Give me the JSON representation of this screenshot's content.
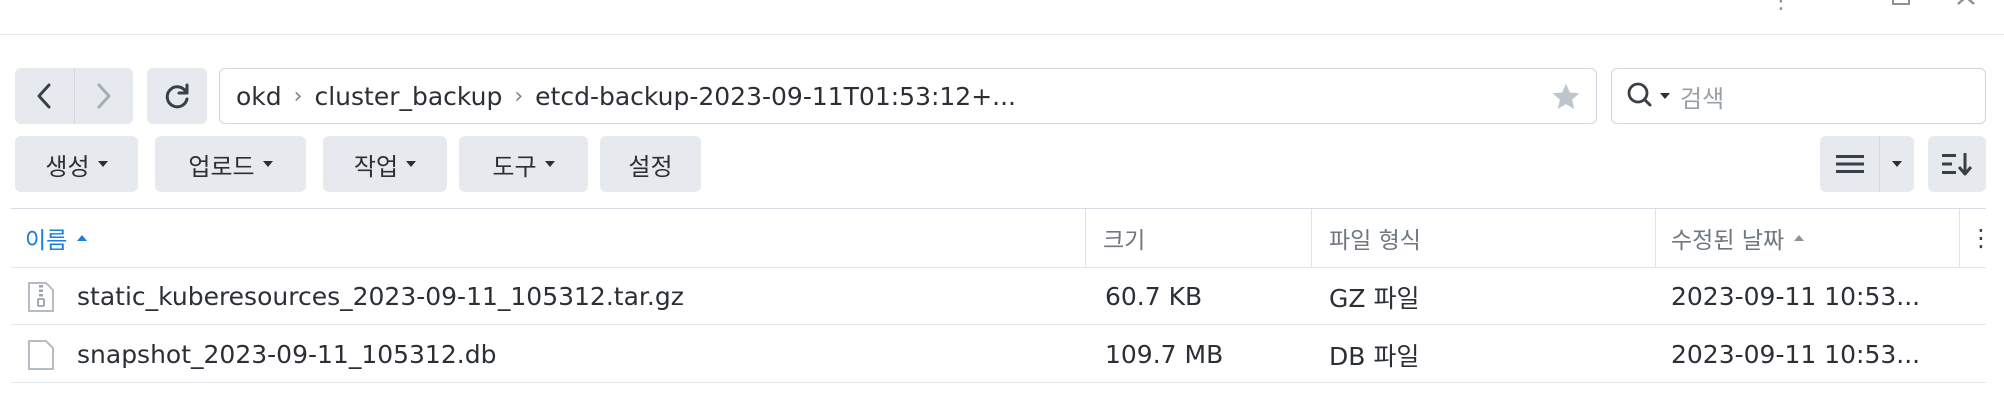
{
  "path": {
    "crumbs": [
      "okd",
      "cluster_backup",
      "etcd-backup-2023-09-11T01:53:12+..."
    ],
    "separator": "›"
  },
  "search": {
    "placeholder": "검색"
  },
  "toolbar": {
    "create": "생성",
    "upload": "업로드",
    "action": "작업",
    "tools": "도구",
    "settings": "설정"
  },
  "table": {
    "headers": {
      "name": "이름",
      "size": "크기",
      "type": "파일 형식",
      "modified": "수정된 날짜"
    },
    "rows": [
      {
        "icon": "archive-file-icon",
        "name": "static_kuberesources_2023-09-11_105312.tar.gz",
        "size": "60.7 KB",
        "type": "GZ 파일",
        "modified": "2023-09-11 10:53..."
      },
      {
        "icon": "file-icon",
        "name": "snapshot_2023-09-11_105312.db",
        "size": "109.7 MB",
        "type": "DB 파일",
        "modified": "2023-09-11 10:53..."
      }
    ]
  },
  "colors": {
    "accent": "#1a7de0",
    "button_bg": "#e6e9ee",
    "border": "#cfd6de"
  }
}
